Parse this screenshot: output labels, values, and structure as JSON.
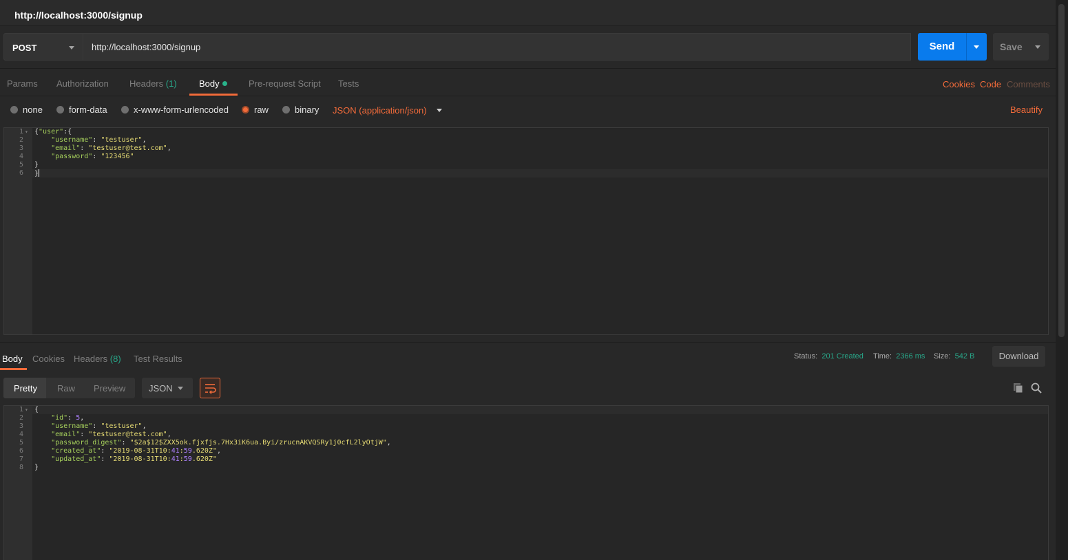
{
  "tab": {
    "title": "http://localhost:3000/signup"
  },
  "request": {
    "method": "POST",
    "url": "http://localhost:3000/signup",
    "send_label": "Send",
    "save_label": "Save"
  },
  "request_tabs": {
    "params": "Params",
    "authorization": "Authorization",
    "headers": "Headers",
    "headers_count": "(1)",
    "body": "Body",
    "prerequest": "Pre-request Script",
    "tests": "Tests",
    "cookies": "Cookies",
    "code": "Code",
    "comments": "Comments"
  },
  "body_types": {
    "none": "none",
    "form_data": "form-data",
    "urlencoded": "x-www-form-urlencoded",
    "raw": "raw",
    "binary": "binary",
    "selected": "raw",
    "content_type": "JSON (application/json)",
    "beautify": "Beautify"
  },
  "request_body_lines": [
    "{\"user\":{",
    "    \"username\": \"testuser\",",
    "    \"email\": \"testuser@test.com\",",
    "    \"password\": \"123456\"",
    "}",
    "}"
  ],
  "response_tabs": {
    "body": "Body",
    "cookies": "Cookies",
    "headers": "Headers",
    "headers_count": "(8)",
    "test_results": "Test Results"
  },
  "response_meta": {
    "status_label": "Status:",
    "status_value": "201 Created",
    "time_label": "Time:",
    "time_value": "2366 ms",
    "size_label": "Size:",
    "size_value": "542 B",
    "download_label": "Download"
  },
  "response_view": {
    "pretty": "Pretty",
    "raw": "Raw",
    "preview": "Preview",
    "format": "JSON"
  },
  "response_body_lines": [
    "{",
    "    \"id\": 5,",
    "    \"username\": \"testuser\",",
    "    \"email\": \"testuser@test.com\",",
    "    \"password_digest\": \"$2a$12$ZXX5ok.fjxfjs.7Hx3iK6ua.Byi/zrucnAKVQSRy1j0cfL2lyOtjW\",",
    "    \"created_at\": \"2019-08-31T10:41:59.620Z\",",
    "    \"updated_at\": \"2019-08-31T10:41:59.620Z\"",
    "}"
  ],
  "colors": {
    "accent": "#f26b3a",
    "send": "#097bed",
    "success": "#28a88a"
  }
}
